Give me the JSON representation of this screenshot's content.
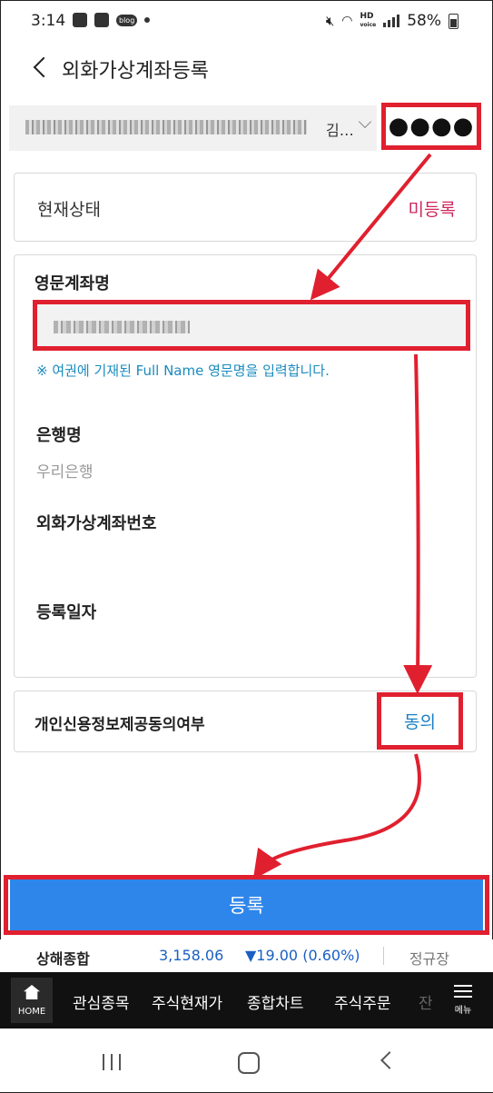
{
  "status_bar": {
    "time": "3:14",
    "blog_icon_text": "blog",
    "hd_text": "HD",
    "voice_text": "voice",
    "battery": "58%"
  },
  "header": {
    "title": "외화가상계좌등록"
  },
  "account": {
    "name_suffix": "김…",
    "password_mask": "●●●●"
  },
  "status_section": {
    "label": "현재상태",
    "value": "미등록"
  },
  "form": {
    "english_name_label": "영문계좌명",
    "english_name_hint": "※ 여권에 기재된 Full Name 영문명을 입력합니다.",
    "bank_label": "은행명",
    "bank_value": "우리은행",
    "account_number_label": "외화가상계좌번호",
    "reg_date_label": "등록일자"
  },
  "consent": {
    "label": "개인신용정보제공동의여부",
    "value": "동의"
  },
  "register_button": "등록",
  "ticker": {
    "index_name": "상해종합",
    "price": "3,158.06",
    "change": "▼19.00 (0.60%)",
    "session": "정규장"
  },
  "bottom_nav": {
    "home": "HOME",
    "items": [
      "관심종목",
      "주식현재가",
      "종합차트",
      "주식주문",
      "잔"
    ],
    "menu": "메뉴"
  },
  "colors": {
    "highlight_red": "#e0202f",
    "button_blue": "#2f86ea",
    "unregistered_pink": "#d0265c",
    "hint_blue": "#1a8bbd"
  }
}
